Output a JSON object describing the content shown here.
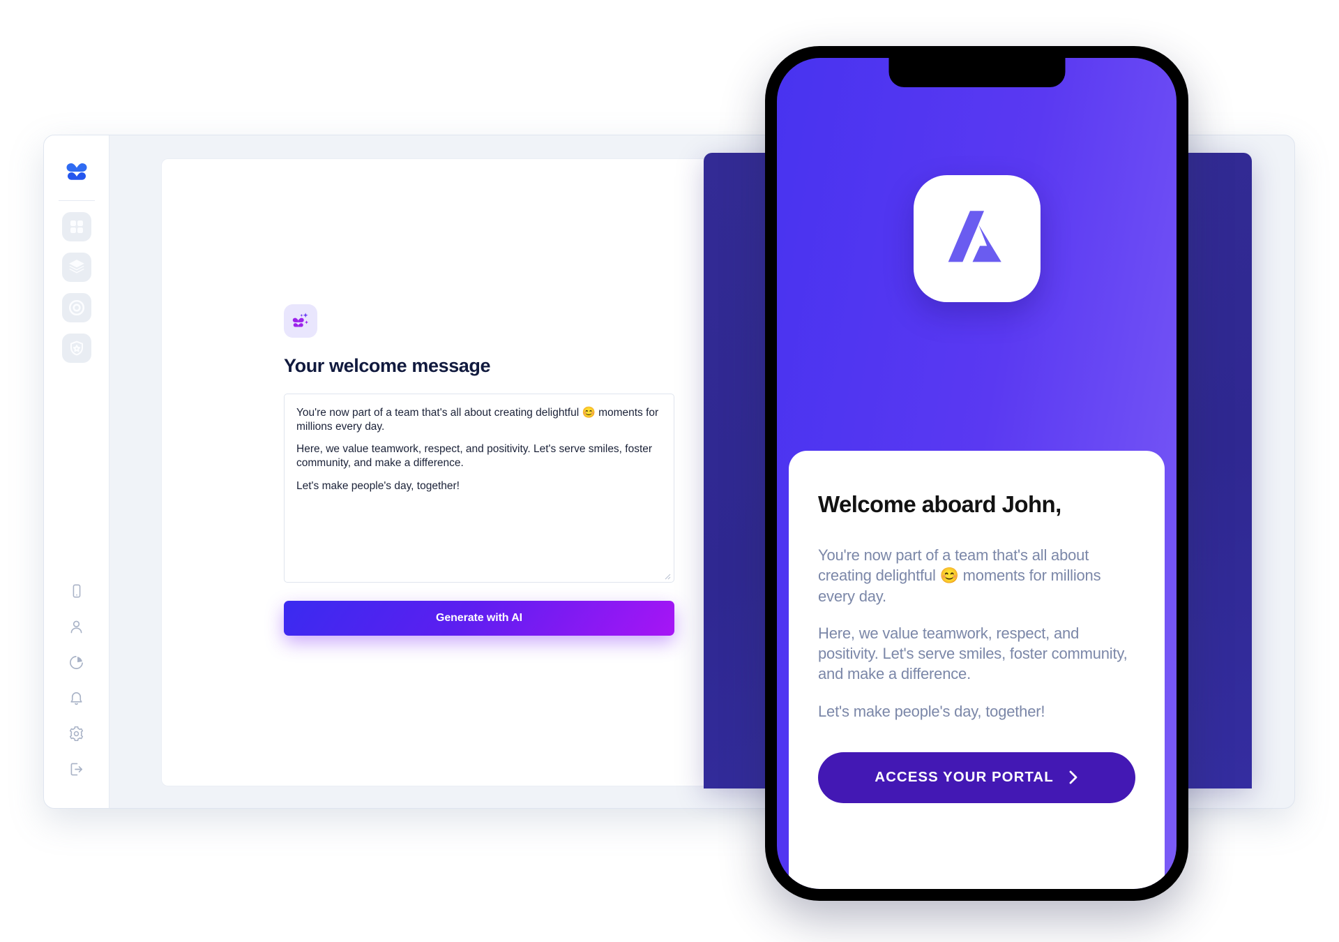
{
  "app_window": {
    "sidebar": {
      "brand_logo_icon": "leaf-stack-logo",
      "nav_tiles": [
        {
          "icon": "grid-dashboard-icon",
          "name": "dashboard"
        },
        {
          "icon": "layers-stack-icon",
          "name": "layers"
        },
        {
          "icon": "target-circle-icon",
          "name": "target"
        },
        {
          "icon": "shield-star-icon",
          "name": "shield"
        }
      ],
      "bottom_items": [
        {
          "icon": "mobile-device-icon",
          "name": "device"
        },
        {
          "icon": "user-person-icon",
          "name": "profile"
        },
        {
          "icon": "pie-chart-icon",
          "name": "analytics"
        },
        {
          "icon": "bell-icon",
          "name": "notifications"
        },
        {
          "icon": "gear-icon",
          "name": "settings"
        },
        {
          "icon": "logout-icon",
          "name": "logout"
        }
      ]
    },
    "form": {
      "badge_icon": "users-sparkle-icon",
      "title": "Your welcome message",
      "message_paragraphs": [
        "You're now part of a team that's all about creating delightful 😊 moments for millions every day.",
        "Here, we value teamwork, respect, and positivity. Let's serve smiles, foster community, and make a difference.",
        "Let's make people's day, together!"
      ],
      "generate_button_label": "Generate with AI",
      "resize_grip_icon": "resize-handle-icon"
    }
  },
  "phone": {
    "app_icon": "abstract-a-logo",
    "welcome_card": {
      "heading": "Welcome aboard John,",
      "paragraphs": [
        "You're now part of a team that's all about creating delightful 😊 moments for millions every day.",
        "Here, we value teamwork, respect, and positivity. Let's serve smiles, foster community, and make a difference.",
        "Let's make people's day, together!"
      ],
      "cta_label": "ACCESS YOUR PORTAL",
      "cta_icon": "chevron-right-icon"
    }
  },
  "colors": {
    "brand_blue": "#2f6bf2",
    "accent_purple": "#5b1ff0",
    "accent_magenta": "#a715f5",
    "deep_purple": "#4318b4",
    "indigo_panel": "#332b95",
    "window_bg": "#f0f3f8",
    "muted_text": "#7b87a8"
  }
}
